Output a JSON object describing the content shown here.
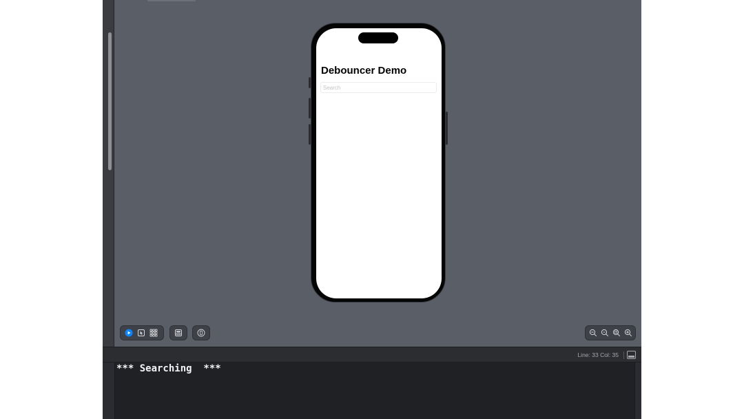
{
  "app": {
    "title": "Debouncer Demo",
    "search_placeholder": "Search"
  },
  "preview_toolbar": {
    "live_mode_icon": "play-circle-icon",
    "selectable_mode_icon": "cursor-select-icon",
    "variants_icon": "grid-icon",
    "device_settings_icon": "device-settings-icon",
    "pin_icon": "pin-icon",
    "accent": "#0a84ff"
  },
  "zoom_controls": {
    "icons": [
      "zoom-out-icon",
      "zoom-100-icon",
      "zoom-fit-icon",
      "zoom-in-icon"
    ]
  },
  "status_bar": {
    "position": "Line: 33  Col: 35"
  },
  "console": {
    "output": "*** Searching  ***"
  }
}
